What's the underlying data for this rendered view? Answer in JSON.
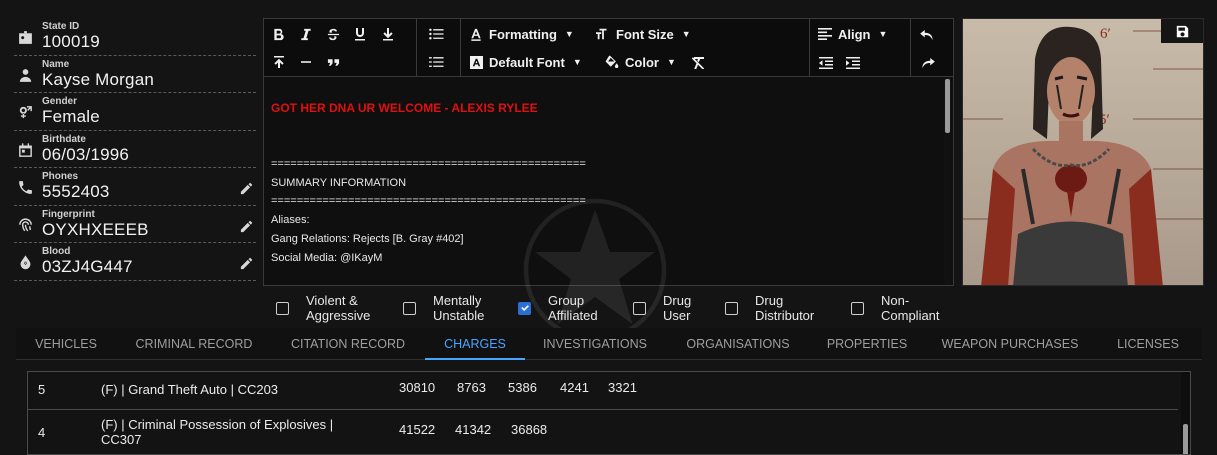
{
  "profile": {
    "fields": [
      {
        "label": "State ID",
        "value": "100019",
        "icon": "id-card-icon",
        "editable": false
      },
      {
        "label": "Name",
        "value": "Kayse Morgan",
        "icon": "person-icon",
        "editable": false
      },
      {
        "label": "Gender",
        "value": "Female",
        "icon": "gender-icon",
        "editable": false
      },
      {
        "label": "Birthdate",
        "value": "06/03/1996",
        "icon": "calendar-icon",
        "editable": false
      },
      {
        "label": "Phones",
        "value": "5552403",
        "icon": "phone-icon",
        "editable": true
      },
      {
        "label": "Fingerprint",
        "value": "OYXHXEEEB",
        "icon": "fingerprint-icon",
        "editable": true
      },
      {
        "label": "Blood",
        "value": "03ZJ4G447",
        "icon": "blood-drop-icon",
        "editable": true
      }
    ]
  },
  "toolbar": {
    "formatting": "Formatting",
    "font_size": "Font Size",
    "default_font": "Default Font",
    "color": "Color",
    "align": "Align"
  },
  "editor": {
    "lines": [
      "GOT HER DNA UR WELCOME - ALEXIS RYLEE",
      "",
      "",
      "=================================================",
      "SUMMARY INFORMATION",
      "=================================================",
      "Aliases:",
      "Gang Relations: Rejects [B. Gray #402]",
      "Social Media: @IKayM"
    ]
  },
  "flags": [
    {
      "label": "Violent & Aggressive",
      "checked": false
    },
    {
      "label": "Mentally Unstable",
      "checked": false
    },
    {
      "label": "Group Affiliated",
      "checked": true
    },
    {
      "label": "Drug User",
      "checked": false
    },
    {
      "label": "Drug Distributor",
      "checked": false
    },
    {
      "label": "Non-Compliant",
      "checked": false
    }
  ],
  "tabs": [
    {
      "label": "VEHICLES",
      "active": false
    },
    {
      "label": "CRIMINAL RECORD",
      "active": false
    },
    {
      "label": "CITATION RECORD",
      "active": false
    },
    {
      "label": "CHARGES",
      "active": true
    },
    {
      "label": "INVESTIGATIONS",
      "active": false
    },
    {
      "label": "ORGANISATIONS",
      "active": false
    },
    {
      "label": "PROPERTIES",
      "active": false
    },
    {
      "label": "WEAPON PURCHASES",
      "active": false
    },
    {
      "label": "LICENSES",
      "active": false
    }
  ],
  "charges": [
    {
      "count": "5",
      "charge": "(F) | Grand Theft Auto | CC203",
      "refs": [
        "30810",
        "8763",
        "5386",
        "4241",
        "3321"
      ]
    },
    {
      "count": "4",
      "charge": "(F) | Criminal Possession of Explosives | CC307",
      "refs": [
        "41522",
        "41342",
        "36868"
      ]
    }
  ],
  "colors": {
    "accent": "#4aa3ff",
    "checkbox_checked": "#2b6fd6",
    "alert_text": "#e01010"
  }
}
